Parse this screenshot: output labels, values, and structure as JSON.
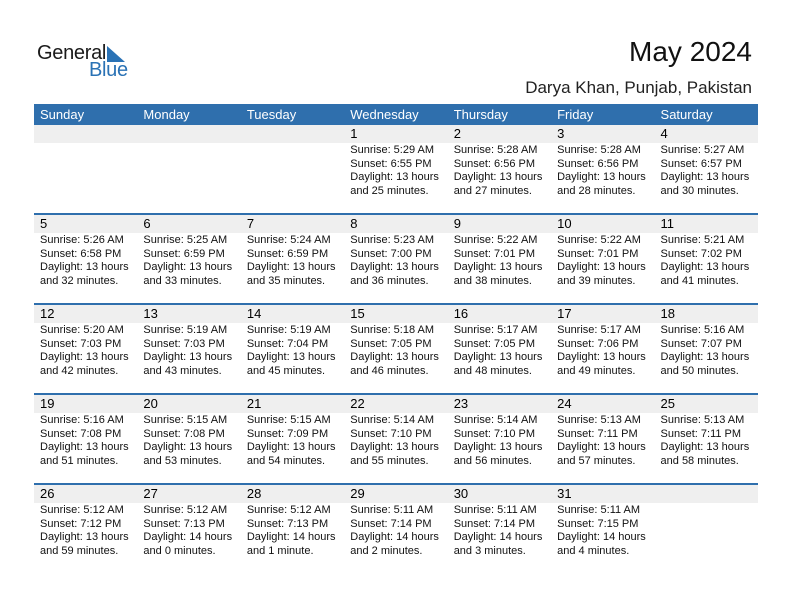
{
  "logo": {
    "word1": "General",
    "word2": "Blue",
    "accent_color": "#2a72b5"
  },
  "header": {
    "title": "May 2024",
    "location": "Darya Khan, Punjab, Pakistan"
  },
  "colors": {
    "header_bg": "#2f6fad",
    "daybar_bg": "#efefef"
  },
  "weekdays": [
    "Sunday",
    "Monday",
    "Tuesday",
    "Wednesday",
    "Thursday",
    "Friday",
    "Saturday"
  ],
  "labels": {
    "sunrise": "Sunrise:",
    "sunset": "Sunset:",
    "daylight": "Daylight:"
  },
  "weeks": [
    [
      null,
      null,
      null,
      {
        "day": "1",
        "sunrise": "Sunrise: 5:29 AM",
        "sunset": "Sunset: 6:55 PM",
        "daylight1": "Daylight: 13 hours",
        "daylight2": "and 25 minutes."
      },
      {
        "day": "2",
        "sunrise": "Sunrise: 5:28 AM",
        "sunset": "Sunset: 6:56 PM",
        "daylight1": "Daylight: 13 hours",
        "daylight2": "and 27 minutes."
      },
      {
        "day": "3",
        "sunrise": "Sunrise: 5:28 AM",
        "sunset": "Sunset: 6:56 PM",
        "daylight1": "Daylight: 13 hours",
        "daylight2": "and 28 minutes."
      },
      {
        "day": "4",
        "sunrise": "Sunrise: 5:27 AM",
        "sunset": "Sunset: 6:57 PM",
        "daylight1": "Daylight: 13 hours",
        "daylight2": "and 30 minutes."
      }
    ],
    [
      {
        "day": "5",
        "sunrise": "Sunrise: 5:26 AM",
        "sunset": "Sunset: 6:58 PM",
        "daylight1": "Daylight: 13 hours",
        "daylight2": "and 32 minutes."
      },
      {
        "day": "6",
        "sunrise": "Sunrise: 5:25 AM",
        "sunset": "Sunset: 6:59 PM",
        "daylight1": "Daylight: 13 hours",
        "daylight2": "and 33 minutes."
      },
      {
        "day": "7",
        "sunrise": "Sunrise: 5:24 AM",
        "sunset": "Sunset: 6:59 PM",
        "daylight1": "Daylight: 13 hours",
        "daylight2": "and 35 minutes."
      },
      {
        "day": "8",
        "sunrise": "Sunrise: 5:23 AM",
        "sunset": "Sunset: 7:00 PM",
        "daylight1": "Daylight: 13 hours",
        "daylight2": "and 36 minutes."
      },
      {
        "day": "9",
        "sunrise": "Sunrise: 5:22 AM",
        "sunset": "Sunset: 7:01 PM",
        "daylight1": "Daylight: 13 hours",
        "daylight2": "and 38 minutes."
      },
      {
        "day": "10",
        "sunrise": "Sunrise: 5:22 AM",
        "sunset": "Sunset: 7:01 PM",
        "daylight1": "Daylight: 13 hours",
        "daylight2": "and 39 minutes."
      },
      {
        "day": "11",
        "sunrise": "Sunrise: 5:21 AM",
        "sunset": "Sunset: 7:02 PM",
        "daylight1": "Daylight: 13 hours",
        "daylight2": "and 41 minutes."
      }
    ],
    [
      {
        "day": "12",
        "sunrise": "Sunrise: 5:20 AM",
        "sunset": "Sunset: 7:03 PM",
        "daylight1": "Daylight: 13 hours",
        "daylight2": "and 42 minutes."
      },
      {
        "day": "13",
        "sunrise": "Sunrise: 5:19 AM",
        "sunset": "Sunset: 7:03 PM",
        "daylight1": "Daylight: 13 hours",
        "daylight2": "and 43 minutes."
      },
      {
        "day": "14",
        "sunrise": "Sunrise: 5:19 AM",
        "sunset": "Sunset: 7:04 PM",
        "daylight1": "Daylight: 13 hours",
        "daylight2": "and 45 minutes."
      },
      {
        "day": "15",
        "sunrise": "Sunrise: 5:18 AM",
        "sunset": "Sunset: 7:05 PM",
        "daylight1": "Daylight: 13 hours",
        "daylight2": "and 46 minutes."
      },
      {
        "day": "16",
        "sunrise": "Sunrise: 5:17 AM",
        "sunset": "Sunset: 7:05 PM",
        "daylight1": "Daylight: 13 hours",
        "daylight2": "and 48 minutes."
      },
      {
        "day": "17",
        "sunrise": "Sunrise: 5:17 AM",
        "sunset": "Sunset: 7:06 PM",
        "daylight1": "Daylight: 13 hours",
        "daylight2": "and 49 minutes."
      },
      {
        "day": "18",
        "sunrise": "Sunrise: 5:16 AM",
        "sunset": "Sunset: 7:07 PM",
        "daylight1": "Daylight: 13 hours",
        "daylight2": "and 50 minutes."
      }
    ],
    [
      {
        "day": "19",
        "sunrise": "Sunrise: 5:16 AM",
        "sunset": "Sunset: 7:08 PM",
        "daylight1": "Daylight: 13 hours",
        "daylight2": "and 51 minutes."
      },
      {
        "day": "20",
        "sunrise": "Sunrise: 5:15 AM",
        "sunset": "Sunset: 7:08 PM",
        "daylight1": "Daylight: 13 hours",
        "daylight2": "and 53 minutes."
      },
      {
        "day": "21",
        "sunrise": "Sunrise: 5:15 AM",
        "sunset": "Sunset: 7:09 PM",
        "daylight1": "Daylight: 13 hours",
        "daylight2": "and 54 minutes."
      },
      {
        "day": "22",
        "sunrise": "Sunrise: 5:14 AM",
        "sunset": "Sunset: 7:10 PM",
        "daylight1": "Daylight: 13 hours",
        "daylight2": "and 55 minutes."
      },
      {
        "day": "23",
        "sunrise": "Sunrise: 5:14 AM",
        "sunset": "Sunset: 7:10 PM",
        "daylight1": "Daylight: 13 hours",
        "daylight2": "and 56 minutes."
      },
      {
        "day": "24",
        "sunrise": "Sunrise: 5:13 AM",
        "sunset": "Sunset: 7:11 PM",
        "daylight1": "Daylight: 13 hours",
        "daylight2": "and 57 minutes."
      },
      {
        "day": "25",
        "sunrise": "Sunrise: 5:13 AM",
        "sunset": "Sunset: 7:11 PM",
        "daylight1": "Daylight: 13 hours",
        "daylight2": "and 58 minutes."
      }
    ],
    [
      {
        "day": "26",
        "sunrise": "Sunrise: 5:12 AM",
        "sunset": "Sunset: 7:12 PM",
        "daylight1": "Daylight: 13 hours",
        "daylight2": "and 59 minutes."
      },
      {
        "day": "27",
        "sunrise": "Sunrise: 5:12 AM",
        "sunset": "Sunset: 7:13 PM",
        "daylight1": "Daylight: 14 hours",
        "daylight2": "and 0 minutes."
      },
      {
        "day": "28",
        "sunrise": "Sunrise: 5:12 AM",
        "sunset": "Sunset: 7:13 PM",
        "daylight1": "Daylight: 14 hours",
        "daylight2": "and 1 minute."
      },
      {
        "day": "29",
        "sunrise": "Sunrise: 5:11 AM",
        "sunset": "Sunset: 7:14 PM",
        "daylight1": "Daylight: 14 hours",
        "daylight2": "and 2 minutes."
      },
      {
        "day": "30",
        "sunrise": "Sunrise: 5:11 AM",
        "sunset": "Sunset: 7:14 PM",
        "daylight1": "Daylight: 14 hours",
        "daylight2": "and 3 minutes."
      },
      {
        "day": "31",
        "sunrise": "Sunrise: 5:11 AM",
        "sunset": "Sunset: 7:15 PM",
        "daylight1": "Daylight: 14 hours",
        "daylight2": "and 4 minutes."
      },
      null
    ]
  ]
}
